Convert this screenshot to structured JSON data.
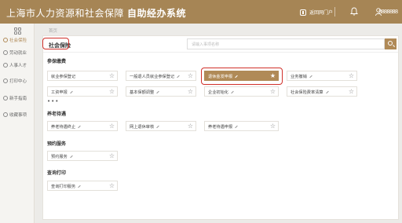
{
  "header": {
    "title": "上海市人力资源和社会保障",
    "subtitle": "自助经办系统",
    "portal_label": "返回网门户",
    "user_name": "8888888"
  },
  "sidebar": {
    "items": [
      {
        "label": "社会保险",
        "icon": "shield-icon",
        "active": true
      },
      {
        "label": "劳动就业",
        "icon": "briefcase-icon",
        "active": false
      },
      {
        "label": "人事人才",
        "icon": "person-icon",
        "active": false
      },
      {
        "label": "打印中心",
        "icon": "printer-icon",
        "active": false
      },
      {
        "label": "新手指南",
        "icon": "guide-icon",
        "active": false
      },
      {
        "label": "收藏事项",
        "icon": "star-icon",
        "active": false
      }
    ]
  },
  "breadcrumb": "首页",
  "panel_title": "社会保险",
  "search": {
    "placeholder": "请输入事项名称"
  },
  "sections": {
    "s1": "参保缴费",
    "s2": "养老待遇",
    "s3": "预约服务",
    "s4": "查询打印"
  },
  "cards": {
    "c1": "就业参保登记",
    "c2": "一般退人员就业参保登记",
    "c3": "退休金发申报",
    "c4": "业务撤销",
    "c5": "工资申报",
    "c6": "基本保额调整",
    "c7": "企业初始化",
    "c8": "社会保险费率清算",
    "c9": "养老待遇终止",
    "c10": "网上退休审核",
    "c11": "养老待遇申报",
    "c12": "预约服务",
    "c13": "查询打印服务"
  },
  "ellipsis": "•••",
  "colors": {
    "accent": "#b08a57",
    "header": "#a68555",
    "highlight": "#d0302a"
  }
}
